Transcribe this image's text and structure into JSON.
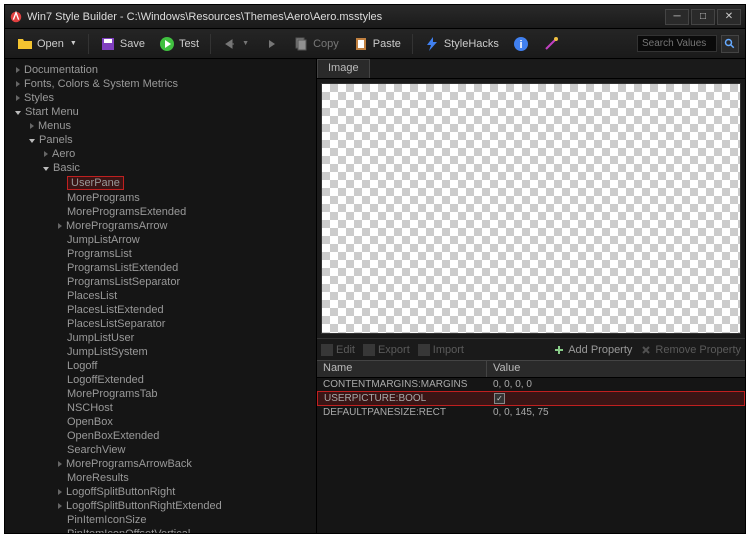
{
  "window": {
    "title": "Win7 Style Builder - C:\\Windows\\Resources\\Themes\\Aero\\Aero.msstyles"
  },
  "toolbar": {
    "open": "Open",
    "save": "Save",
    "test": "Test",
    "copy": "Copy",
    "paste": "Paste",
    "stylehacks": "StyleHacks",
    "search_placeholder": "Search Values"
  },
  "tree": {
    "documentation": "Documentation",
    "fonts": "Fonts, Colors & System Metrics",
    "styles": "Styles",
    "startmenu": "Start Menu",
    "menus": "Menus",
    "panels": "Panels",
    "aero": "Aero",
    "basic": "Basic",
    "basic_items": [
      "UserPane",
      "MorePrograms",
      "MoreProgramsExtended",
      "MoreProgramsArrow",
      "JumpListArrow",
      "ProgramsList",
      "ProgramsListExtended",
      "ProgramsListSeparator",
      "PlacesList",
      "PlacesListExtended",
      "PlacesListSeparator",
      "JumpListUser",
      "JumpListSystem",
      "Logoff",
      "LogoffExtended",
      "MoreProgramsTab",
      "NSCHost",
      "OpenBox",
      "OpenBoxExtended",
      "SearchView",
      "MoreProgramsArrowBack",
      "MoreResults",
      "LogoffSplitButtonRight",
      "LogoffSplitButtonRightExtended",
      "PinItemIconSize",
      "PinItemIconOffsetVertical"
    ],
    "expandable_items": [
      3,
      20,
      22,
      23
    ]
  },
  "image_panel": {
    "tab": "Image"
  },
  "props": {
    "edit": "Edit",
    "export": "Export",
    "import": "Import",
    "add": "Add Property",
    "remove": "Remove Property",
    "col_name": "Name",
    "col_value": "Value",
    "rows": [
      {
        "name": "CONTENTMARGINS:MARGINS",
        "value": "0, 0, 0, 0",
        "checked": false,
        "hl": false
      },
      {
        "name": "USERPICTURE:BOOL",
        "value": "",
        "checked": true,
        "hl": true
      },
      {
        "name": "DEFAULTPANESIZE:RECT",
        "value": "0, 0, 145, 75",
        "checked": false,
        "hl": false
      }
    ]
  }
}
